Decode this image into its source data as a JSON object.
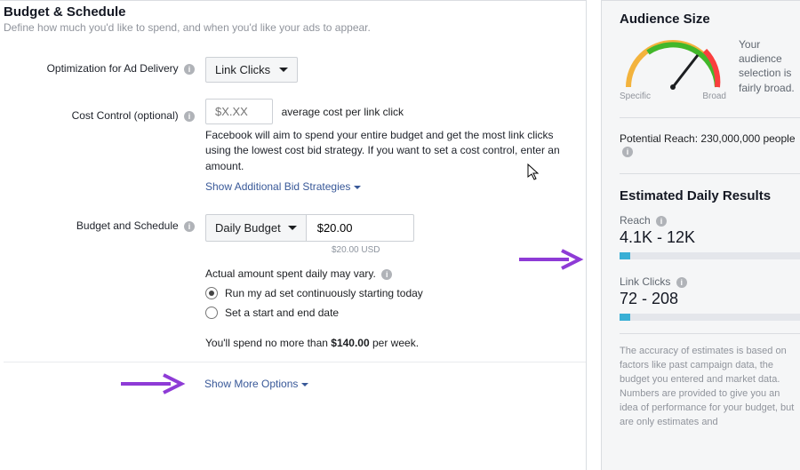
{
  "header": {
    "title": "Budget & Schedule",
    "subtitle": "Define how much you'd like to spend, and when you'd like your ads to appear."
  },
  "optimization": {
    "label": "Optimization for Ad Delivery",
    "value": "Link Clicks"
  },
  "cost": {
    "label": "Cost Control (optional)",
    "placeholder": "$X.XX",
    "suffix": "average cost per link click",
    "desc": "Facebook will aim to spend your entire budget and get the most link clicks using the lowest cost bid strategy. If you want to set a cost control, enter an amount.",
    "link": "Show Additional Bid Strategies"
  },
  "budget": {
    "label": "Budget and Schedule",
    "type": "Daily Budget",
    "amount": "$20.00",
    "amount_hint": "$20.00 USD",
    "vary": "Actual amount spent daily may vary.",
    "opt1": "Run my ad set continuously starting today",
    "opt2": "Set a start and end date",
    "spend_prefix": "You'll spend no more than ",
    "spend_amount": "$140.00",
    "spend_suffix": " per week."
  },
  "more": "Show More Options",
  "audience": {
    "title": "Audience Size",
    "specific": "Specific",
    "broad": "Broad",
    "verdict": "Your audience selection is fairly broad.",
    "reach_line_prefix": "Potential Reach: ",
    "reach_line_value": "230,000,000 people"
  },
  "results": {
    "title": "Estimated Daily Results",
    "reach_label": "Reach",
    "reach_value": "4.1K - 12K",
    "clicks_label": "Link Clicks",
    "clicks_value": "72 - 208",
    "footer": "The accuracy of estimates is based on factors like past campaign data, the budget you entered and market data. Numbers are provided to give you an idea of performance for your budget, but are only estimates and"
  }
}
